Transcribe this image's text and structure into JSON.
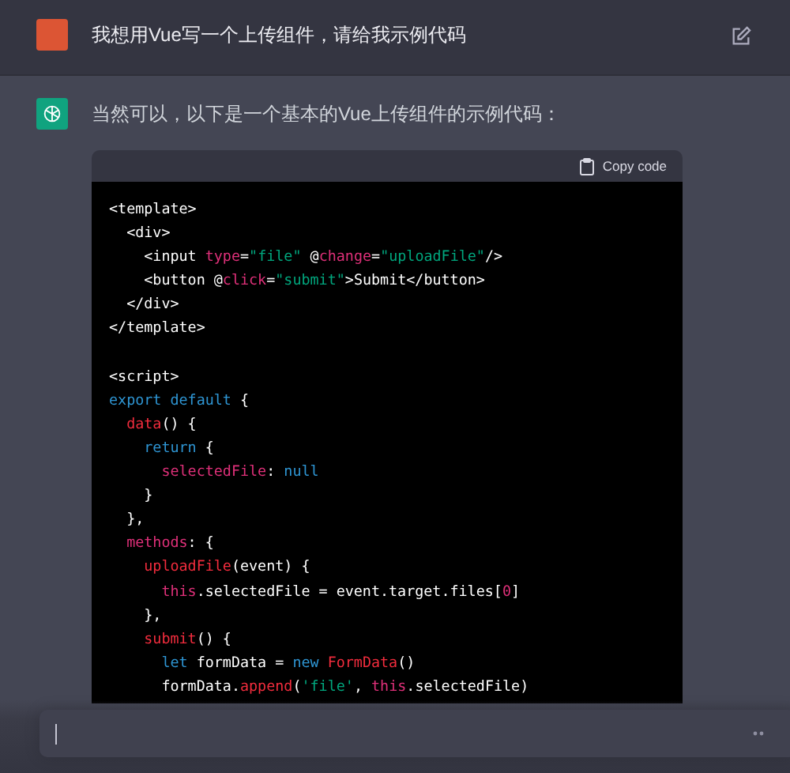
{
  "user_message": {
    "text": "我想用Vue写一个上传组件，请给我示例代码"
  },
  "assistant_message": {
    "text": "当然可以，以下是一个基本的Vue上传组件的示例代码：",
    "code_block": {
      "copy_label": "Copy code",
      "lines": [
        {
          "kind": "code",
          "tokens": [
            {
              "t": "<template>",
              "kind": "plain"
            }
          ]
        },
        {
          "kind": "code",
          "tokens": [
            {
              "t": "  <div>",
              "kind": "plain"
            }
          ]
        },
        {
          "kind": "code",
          "tokens": [
            {
              "t": "    <input ",
              "kind": "plain"
            },
            {
              "t": "type",
              "kind": "attr"
            },
            {
              "t": "=",
              "kind": "plain"
            },
            {
              "t": "\"file\"",
              "kind": "string"
            },
            {
              "t": " @",
              "kind": "plain"
            },
            {
              "t": "change",
              "kind": "attr"
            },
            {
              "t": "=",
              "kind": "plain"
            },
            {
              "t": "\"uploadFile\"",
              "kind": "string"
            },
            {
              "t": "/>",
              "kind": "plain"
            }
          ]
        },
        {
          "kind": "code",
          "tokens": [
            {
              "t": "    <button @",
              "kind": "plain"
            },
            {
              "t": "click",
              "kind": "attr"
            },
            {
              "t": "=",
              "kind": "plain"
            },
            {
              "t": "\"submit\"",
              "kind": "string"
            },
            {
              "t": ">Submit</button>",
              "kind": "plain"
            }
          ]
        },
        {
          "kind": "code",
          "tokens": [
            {
              "t": "  </div>",
              "kind": "plain"
            }
          ]
        },
        {
          "kind": "code",
          "tokens": [
            {
              "t": "</template>",
              "kind": "plain"
            }
          ]
        },
        {
          "kind": "blank"
        },
        {
          "kind": "code",
          "tokens": [
            {
              "t": "<script>",
              "kind": "plain"
            }
          ]
        },
        {
          "kind": "code",
          "tokens": [
            {
              "t": "export default",
              "kind": "keyword"
            },
            {
              "t": " {",
              "kind": "plain"
            }
          ]
        },
        {
          "kind": "code",
          "tokens": [
            {
              "t": "  data",
              "kind": "function"
            },
            {
              "t": "() {",
              "kind": "plain"
            }
          ]
        },
        {
          "kind": "code",
          "tokens": [
            {
              "t": "    return",
              "kind": "keyword"
            },
            {
              "t": " {",
              "kind": "plain"
            }
          ]
        },
        {
          "kind": "code",
          "tokens": [
            {
              "t": "      selectedFile",
              "kind": "attr"
            },
            {
              "t": ": ",
              "kind": "plain"
            },
            {
              "t": "null",
              "kind": "keyword"
            }
          ]
        },
        {
          "kind": "code",
          "tokens": [
            {
              "t": "    }",
              "kind": "plain"
            }
          ]
        },
        {
          "kind": "code",
          "tokens": [
            {
              "t": "  },",
              "kind": "plain"
            }
          ]
        },
        {
          "kind": "code",
          "tokens": [
            {
              "t": "  methods",
              "kind": "attr"
            },
            {
              "t": ": {",
              "kind": "plain"
            }
          ]
        },
        {
          "kind": "code",
          "tokens": [
            {
              "t": "    uploadFile",
              "kind": "function"
            },
            {
              "t": "(event) {",
              "kind": "plain"
            }
          ]
        },
        {
          "kind": "code",
          "tokens": [
            {
              "t": "      this",
              "kind": "attr"
            },
            {
              "t": ".selectedFile = event.target.files[",
              "kind": "plain"
            },
            {
              "t": "0",
              "kind": "attr"
            },
            {
              "t": "]",
              "kind": "plain"
            }
          ]
        },
        {
          "kind": "code",
          "tokens": [
            {
              "t": "    },",
              "kind": "plain"
            }
          ]
        },
        {
          "kind": "code",
          "tokens": [
            {
              "t": "    submit",
              "kind": "function"
            },
            {
              "t": "() {",
              "kind": "plain"
            }
          ]
        },
        {
          "kind": "code",
          "tokens": [
            {
              "t": "      let",
              "kind": "keyword"
            },
            {
              "t": " formData = ",
              "kind": "plain"
            },
            {
              "t": "new ",
              "kind": "keyword"
            },
            {
              "t": "FormData",
              "kind": "function"
            },
            {
              "t": "()",
              "kind": "plain"
            }
          ]
        },
        {
          "kind": "code",
          "tokens": [
            {
              "t": "      formData.",
              "kind": "plain"
            },
            {
              "t": "append",
              "kind": "function"
            },
            {
              "t": "(",
              "kind": "plain"
            },
            {
              "t": "'file'",
              "kind": "string"
            },
            {
              "t": ", ",
              "kind": "plain"
            },
            {
              "t": "this",
              "kind": "attr"
            },
            {
              "t": ".selectedFile)",
              "kind": "plain"
            }
          ]
        }
      ]
    }
  }
}
